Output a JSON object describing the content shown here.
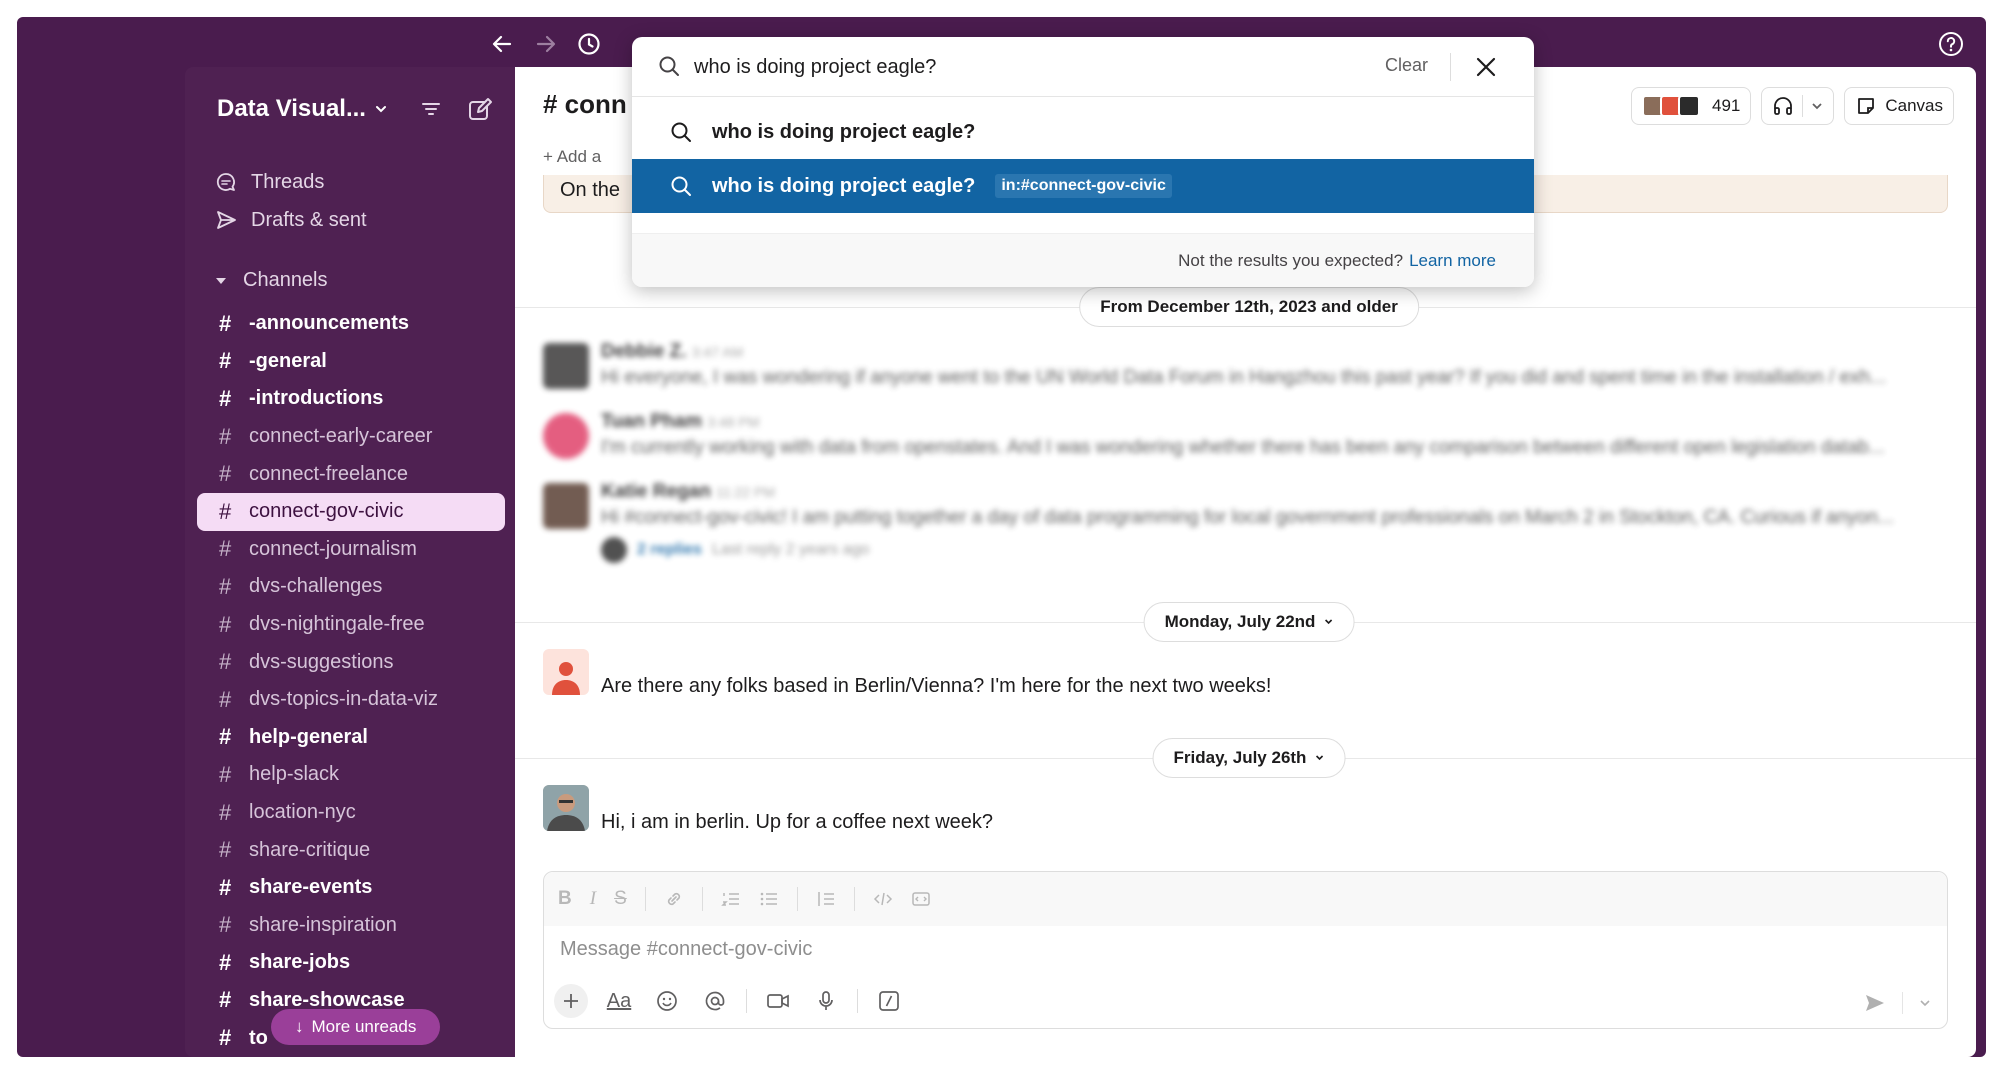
{
  "workspace": {
    "name": "Data Visual..."
  },
  "nav": [
    {
      "label": "Threads",
      "icon": "threads-icon"
    },
    {
      "label": "Drafts & sent",
      "icon": "send-icon"
    }
  ],
  "channels_section": {
    "label": "Channels"
  },
  "channels": [
    {
      "name": "-announcements",
      "bold": true
    },
    {
      "name": "-general",
      "bold": true
    },
    {
      "name": "-introductions",
      "bold": true
    },
    {
      "name": "connect-early-career",
      "bold": false
    },
    {
      "name": "connect-freelance",
      "bold": false
    },
    {
      "name": "connect-gov-civic",
      "bold": false,
      "active": true
    },
    {
      "name": "connect-journalism",
      "bold": false
    },
    {
      "name": "dvs-challenges",
      "bold": false
    },
    {
      "name": "dvs-nightingale-free",
      "bold": false
    },
    {
      "name": "dvs-suggestions",
      "bold": false
    },
    {
      "name": "dvs-topics-in-data-viz",
      "bold": false
    },
    {
      "name": "help-general",
      "bold": true
    },
    {
      "name": "help-slack",
      "bold": false
    },
    {
      "name": "location-nyc",
      "bold": false
    },
    {
      "name": "share-critique",
      "bold": false
    },
    {
      "name": "share-events",
      "bold": true
    },
    {
      "name": "share-inspiration",
      "bold": false
    },
    {
      "name": "share-jobs",
      "bold": true
    },
    {
      "name": "share-showcase",
      "bold": true
    },
    {
      "name": "to",
      "bold": true
    }
  ],
  "more_unreads": "More unreads",
  "channel_header": {
    "title": "# conn",
    "add_label": "Add a",
    "member_count": "491",
    "canvas_label": "Canvas"
  },
  "banner_text": "On the",
  "dates": {
    "older": "From December 12th, 2023 and older",
    "monday": "Monday, July 22nd",
    "friday": "Friday, July 26th"
  },
  "blurred_messages": [
    {
      "name": "Debbie Z.",
      "time": "3:47 AM",
      "text": "Hi everyone, I was wondering if anyone went to the UN World Data Forum in Hangzhou this past year? If you did and spent time in the installation / exh..."
    },
    {
      "name": "Tuan Pham",
      "time": "3:48 PM",
      "text": "I'm currently working with data from openstates. And I was wondering whether there has been any comparison between different open legislation datab..."
    },
    {
      "name": "Katie Regan",
      "time": "11:22 PM",
      "text": "Hi #connect-gov-civic! I am putting together a day of data programming for local government professionals on March 2 in Stockton, CA. Curious if anyon..."
    }
  ],
  "thread_reply": {
    "replies": "2 replies",
    "last_reply": "Last reply 2 years ago"
  },
  "messages": [
    {
      "text": "Are there any folks based in Berlin/Vienna? I'm here for the next two weeks!"
    },
    {
      "text": "Hi, i am in berlin. Up for a coffee next week?"
    }
  ],
  "composer": {
    "placeholder": "Message #connect-gov-civic"
  },
  "search": {
    "query": "who is doing project eagle?",
    "clear_label": "Clear",
    "suggestion_1": "who is doing project eagle?",
    "suggestion_2": "who is doing project eagle?",
    "suggestion_2_modifier": "in:#connect-gov-civic",
    "footer_text": "Not the results you expected?",
    "footer_link": "Learn more"
  },
  "colors": {
    "aubergine": "#4a1c4e",
    "sidebar": "#4f2152",
    "selected": "#1264a3",
    "active_channel": "#f5dcf5"
  }
}
